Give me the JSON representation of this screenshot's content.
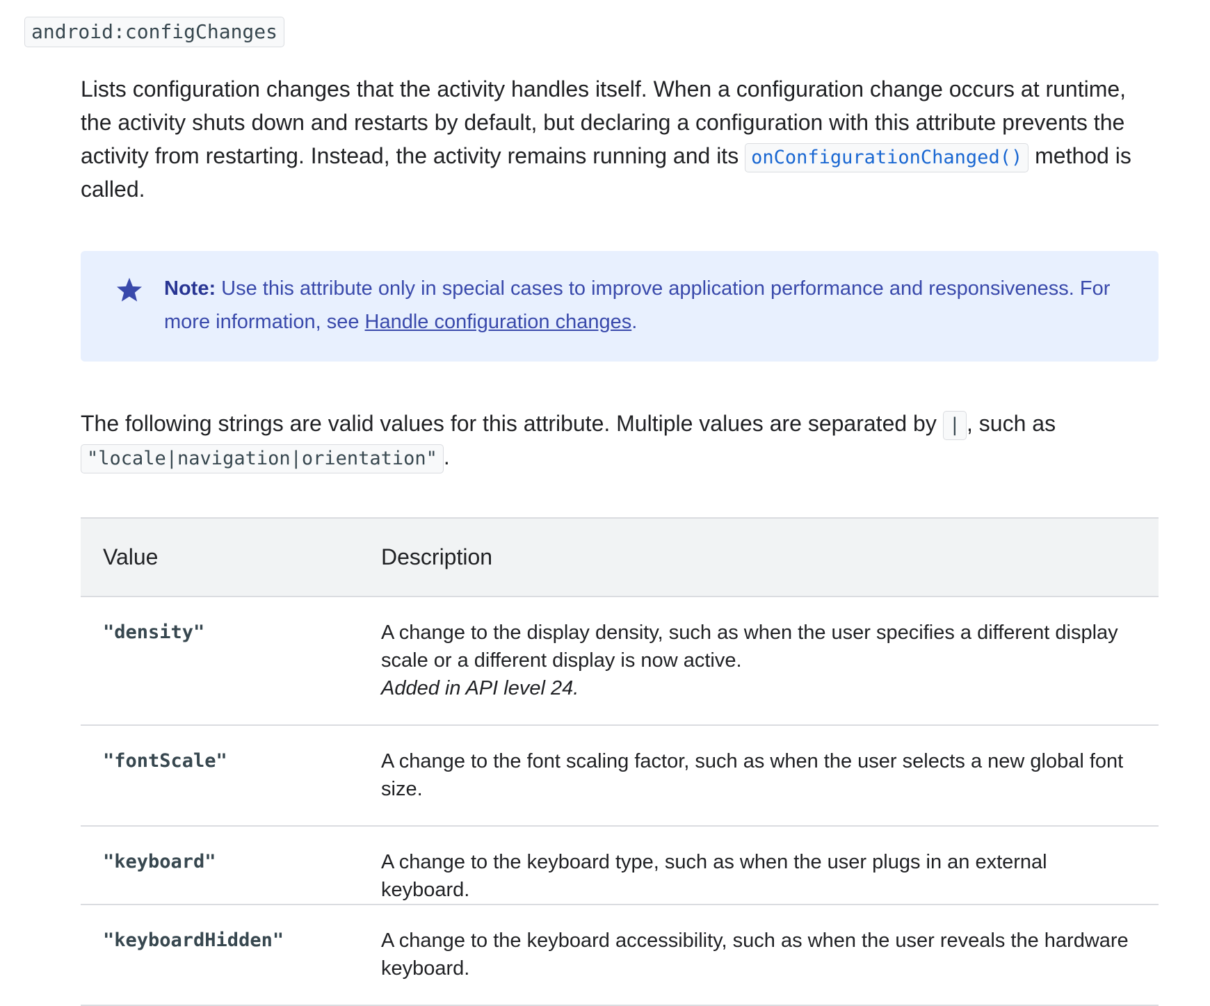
{
  "attribute": {
    "name": "android:configChanges"
  },
  "intro": {
    "text_before": "Lists configuration changes that the activity handles itself. When a configuration change occurs at runtime, the activity shuts down and restarts by default, but declaring a configuration with this attribute prevents the activity from restarting. Instead, the activity remains running and its ",
    "method_link": "onConfigurationChanged()",
    "text_after": " method is called."
  },
  "note": {
    "icon": "star-icon",
    "label": "Note:",
    "text": " Use this attribute only in special cases to improve application performance and responsiveness. For more information, see ",
    "link_text": "Handle configuration changes",
    "end": "."
  },
  "values_intro": {
    "text_before": "The following strings are valid values for this attribute. Multiple values are separated by ",
    "separator": "|",
    "text_middle": ", such as ",
    "example": "\"locale|navigation|orientation\"",
    "text_after": "."
  },
  "table": {
    "headers": [
      "Value",
      "Description"
    ],
    "rows": [
      {
        "value": "\"density\"",
        "description": "A change to the display density, such as when the user specifies a different display scale or a different display is now active.",
        "added": "Added in API level 24."
      },
      {
        "value": "\"fontScale\"",
        "description": "A change to the font scaling factor, such as when the user selects a new global font size."
      },
      {
        "value": "\"keyboard\"",
        "description": "A change to the keyboard type, such as when the user plugs in an external keyboard."
      },
      {
        "value": "\"keyboardHidden\"",
        "description": "A change to the keyboard accessibility, such as when the user reveals the hardware keyboard."
      }
    ]
  },
  "colors": {
    "note_background": "#e8f0fe",
    "note_text": "#3949ab",
    "code_link": "#1967d2",
    "table_header_bg": "#f1f3f4"
  }
}
